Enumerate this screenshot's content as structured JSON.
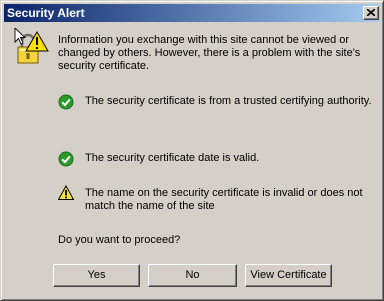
{
  "window": {
    "title": "Security Alert"
  },
  "message": {
    "intro": "Information you exchange with this site cannot be viewed or changed by others. However, there is a problem with the site's security certificate.",
    "items": [
      {
        "status": "ok",
        "icon": "green-check-icon",
        "text": "The security certificate is from a trusted certifying authority."
      },
      {
        "status": "ok",
        "icon": "green-check-icon",
        "text": "The security certificate date is valid."
      },
      {
        "status": "warning",
        "icon": "yellow-warning-icon",
        "text": "The name on the security certificate is invalid or does not match the name of the site"
      }
    ],
    "question": "Do you want to proceed?"
  },
  "buttons": {
    "yes": "Yes",
    "no": "No",
    "view_certificate": "View Certificate"
  },
  "icons": {
    "title_close": "close-icon",
    "alert": "security-alert-lock-icon"
  },
  "colors": {
    "titlebar_start": "#0a246a",
    "titlebar_end": "#a6caf0",
    "dialog_bg": "#d4d0c8",
    "ok_green": "#2a9a2a",
    "warning_yellow": "#f7e23a"
  }
}
